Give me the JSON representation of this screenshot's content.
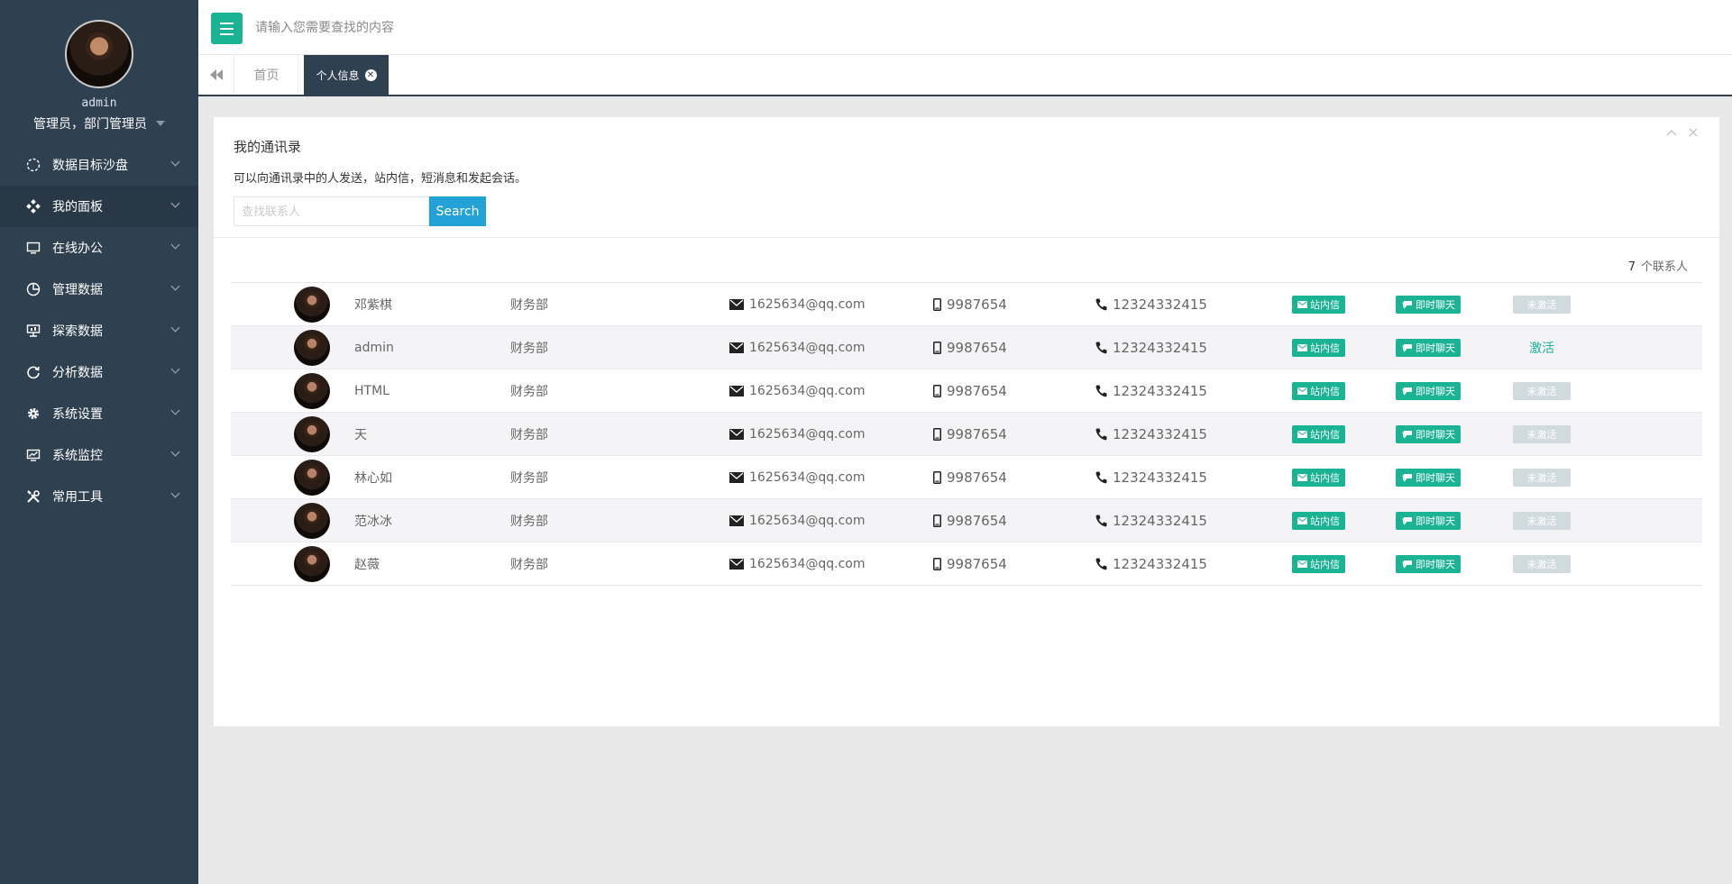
{
  "profile": {
    "name": "admin",
    "role": "管理员，部门管理员"
  },
  "sidebar": {
    "items": [
      {
        "label": "数据目标沙盘",
        "icon": "dashed-circle-icon"
      },
      {
        "label": "我的面板",
        "icon": "diamonds-icon"
      },
      {
        "label": "在线办公",
        "icon": "monitor-icon"
      },
      {
        "label": "管理数据",
        "icon": "pie-chart-icon"
      },
      {
        "label": "探索数据",
        "icon": "presentation-icon"
      },
      {
        "label": "分析数据",
        "icon": "refresh-icon"
      },
      {
        "label": "系统设置",
        "icon": "gear-icon"
      },
      {
        "label": "系统监控",
        "icon": "line-chart-icon"
      },
      {
        "label": "常用工具",
        "icon": "tools-icon"
      }
    ]
  },
  "topbar": {
    "search_placeholder": "请输入您需要查找的内容"
  },
  "tabs": {
    "home": "首页",
    "active": "个人信息"
  },
  "panel": {
    "title": "我的通讯录",
    "description": "可以向通讯录中的人发送，站内信，短消息和发起会话。",
    "search_placeholder": "查找联系人",
    "search_button": "Search",
    "count": "7",
    "count_suffix": "个联系人"
  },
  "actions": {
    "message": "站内信",
    "chat": "即时聊天",
    "inactive": "未激活",
    "activate": "激活"
  },
  "contacts": [
    {
      "name": "邓紫棋",
      "dept": "财务部",
      "email": "1625634@qq.com",
      "mobile": "9987654",
      "phone": "12324332415",
      "status": "inactive"
    },
    {
      "name": "admin",
      "dept": "财务部",
      "email": "1625634@qq.com",
      "mobile": "9987654",
      "phone": "12324332415",
      "status": "active"
    },
    {
      "name": "HTML",
      "dept": "财务部",
      "email": "1625634@qq.com",
      "mobile": "9987654",
      "phone": "12324332415",
      "status": "inactive"
    },
    {
      "name": "天",
      "dept": "财务部",
      "email": "1625634@qq.com",
      "mobile": "9987654",
      "phone": "12324332415",
      "status": "inactive"
    },
    {
      "name": "林心如",
      "dept": "财务部",
      "email": "1625634@qq.com",
      "mobile": "9987654",
      "phone": "12324332415",
      "status": "inactive"
    },
    {
      "name": "范冰冰",
      "dept": "财务部",
      "email": "1625634@qq.com",
      "mobile": "9987654",
      "phone": "12324332415",
      "status": "inactive"
    },
    {
      "name": "赵薇",
      "dept": "财务部",
      "email": "1625634@qq.com",
      "mobile": "9987654",
      "phone": "12324332415",
      "status": "inactive"
    }
  ],
  "colors": {
    "sidebar": "#2f4050",
    "accent": "#1ab394",
    "search_button": "#23a2d8",
    "inactive": "#d1dade"
  }
}
